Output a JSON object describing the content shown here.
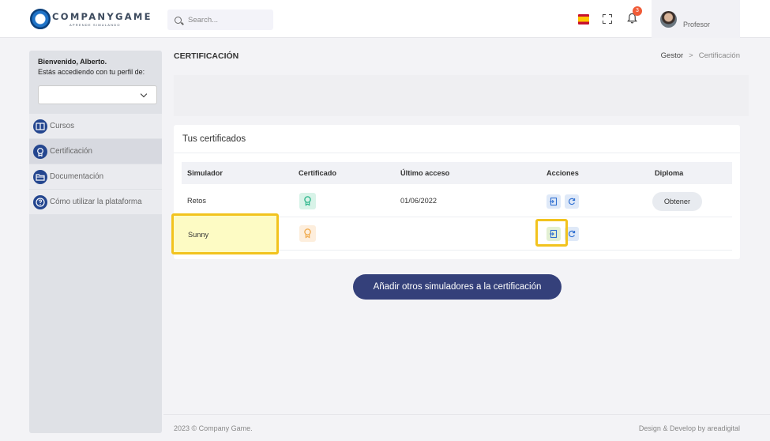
{
  "header": {
    "logo_text": "COMPANYGAME",
    "logo_tagline": "APRENDE SIMULANDO",
    "search_placeholder": "Search...",
    "notification_count": "3",
    "user_role": "Profesor"
  },
  "sidebar": {
    "welcome": "Bienvenido, Alberto.",
    "profile_prompt": "Estás accediendo con tu perfil de:",
    "profile_value": "",
    "items": [
      {
        "label": "Cursos",
        "icon": "book-icon"
      },
      {
        "label": "Certificación",
        "icon": "award-icon"
      },
      {
        "label": "Documentación",
        "icon": "folder-icon"
      },
      {
        "label": "Cómo utilizar la plataforma",
        "icon": "help-icon"
      }
    ]
  },
  "page": {
    "title": "CERTIFICACIÓN",
    "breadcrumb": [
      "Gestor",
      "Certificación"
    ]
  },
  "certificates": {
    "title": "Tus certificados",
    "columns": [
      "Simulador",
      "Certificado",
      "Último acceso",
      "Acciones",
      "Diploma"
    ],
    "rows": [
      {
        "simulator": "Retos",
        "certified": true,
        "last_access": "01/06/2022",
        "diploma": "Obtener"
      },
      {
        "simulator": "Sunny",
        "certified": false,
        "last_access": "",
        "diploma": ""
      }
    ],
    "add_button": "Añadir otros simuladores a la certificación"
  },
  "footer": {
    "copyright": "2023 © Company Game.",
    "credit": "Design & Develop by areadigital"
  },
  "colors": {
    "accent": "#34407a",
    "nav_icon": "#24468f",
    "certified_icon": "#2bb58a",
    "pending_icon": "#f0a94a",
    "highlight": "#f2c31e",
    "badge": "#f05b37"
  }
}
